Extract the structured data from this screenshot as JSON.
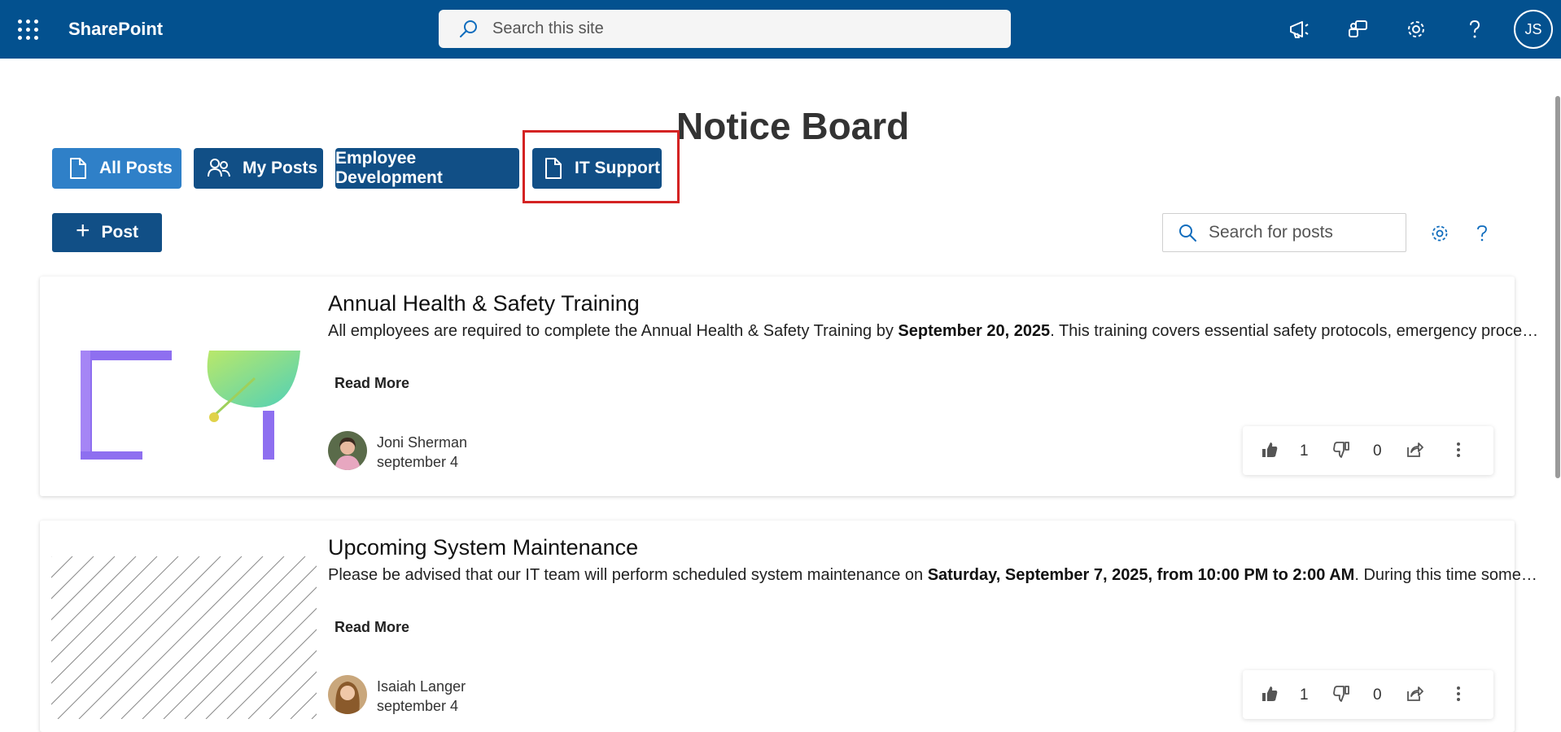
{
  "header": {
    "brand": "SharePoint",
    "search_placeholder": "Search this site",
    "avatar_initials": "JS"
  },
  "page": {
    "title": "Notice Board"
  },
  "tabs": [
    {
      "label": "All Posts",
      "icon": "document-icon"
    },
    {
      "label": "My Posts",
      "icon": "people-icon"
    },
    {
      "label": "Employee Development"
    },
    {
      "label": "IT Support",
      "icon": "document-icon"
    }
  ],
  "toolbar": {
    "post_label": "Post",
    "search_placeholder": "Search for posts"
  },
  "posts": [
    {
      "title": "Annual Health & Safety Training",
      "desc_before": "All employees are required to complete the Annual Health & Safety Training by ",
      "desc_bold": "September 20, 2025",
      "desc_after": ". This training covers essential safety protocols, emergency procedures and workplace safety practices.",
      "read_more": "Read More",
      "author": "Joni Sherman",
      "date": "september 4",
      "likes": "1",
      "dislikes": "0"
    },
    {
      "title": "Upcoming System Maintenance",
      "desc_before": "Please be advised that our IT team will perform scheduled system maintenance on ",
      "desc_bold": "Saturday, September 7, 2025, from 10:00 PM to 2:00 AM",
      "desc_after": ". During this time some services may be unavailable.",
      "read_more": "Read More",
      "author": "Isaiah Langer",
      "date": "september 4",
      "likes": "1",
      "dislikes": "0"
    }
  ],
  "colors": {
    "header_bg": "#03518f",
    "tab_active": "#2f80c8",
    "tab_default": "#114f86",
    "highlight": "#d42323"
  }
}
